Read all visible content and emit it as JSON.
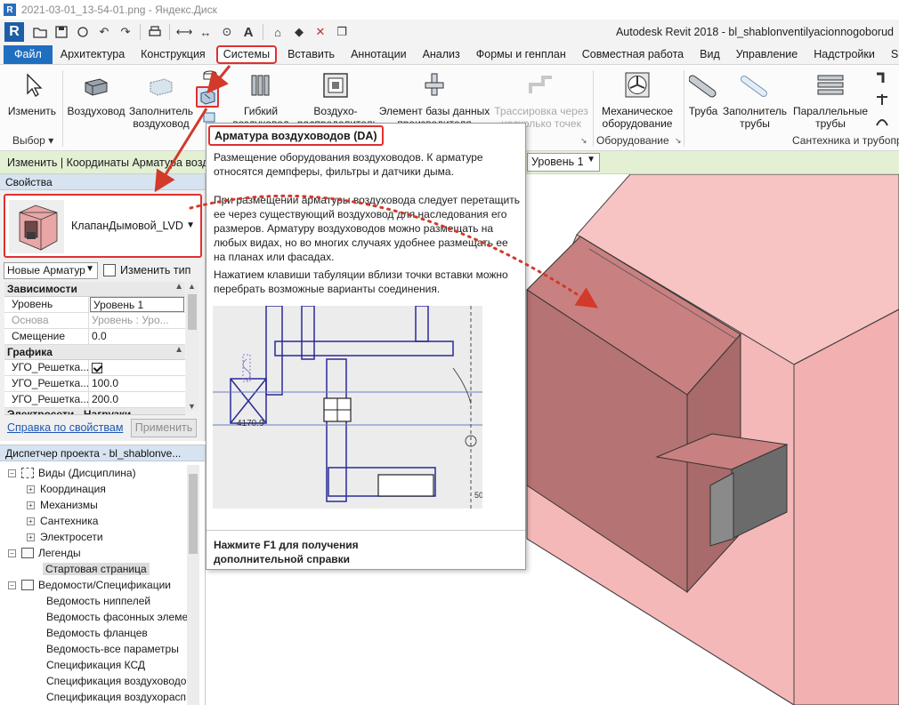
{
  "viewer": {
    "title": "2021-03-01_13-54-01.png - Яндекс.Диск"
  },
  "app": {
    "logo": "R",
    "title": "Autodesk Revit 2018 -    bl_shablonventilyacionnogoborud"
  },
  "qat_icons": [
    "open-icon",
    "save-icon",
    "sync-icon",
    "undo-icon",
    "redo-icon",
    "print-icon",
    "measure-icon",
    "dimension-icon",
    "tag-icon",
    "text-icon",
    "3d-view-icon",
    "section-icon",
    "close-views-icon",
    "switch-windows-icon"
  ],
  "tabs": [
    {
      "label": "Файл",
      "kind": "file"
    },
    {
      "label": "Архитектура"
    },
    {
      "label": "Конструкция"
    },
    {
      "label": "Системы",
      "kind": "active"
    },
    {
      "label": "Вставить"
    },
    {
      "label": "Аннотации"
    },
    {
      "label": "Анализ"
    },
    {
      "label": "Формы и генплан"
    },
    {
      "label": "Совместная работа"
    },
    {
      "label": "Вид"
    },
    {
      "label": "Управление"
    },
    {
      "label": "Надстройки"
    },
    {
      "label": "Site D"
    }
  ],
  "ribbon": {
    "modify": "Изменить",
    "duct": "Воздуховод",
    "duct_placeholder_1": "Заполнитель",
    "duct_placeholder_2": "воздуховод",
    "flex_1": "Гибкий",
    "flex_2": "воздуховод",
    "terminal_1": "Воздухо-",
    "terminal_2": "распределитель",
    "db_1": "Элемент базы данных",
    "db_2": "производителя",
    "route_1": "Трассировка через",
    "route_2": "несколько точек",
    "mech_1": "Механическое",
    "mech_2": "оборудование",
    "pipe": "Труба",
    "pipe_placeholder_1": "Заполнитель",
    "pipe_placeholder_2": "трубы",
    "parallel_1": "Параллельные",
    "parallel_2": "трубы",
    "panel_select": "Выбор",
    "panel_equipment": "Оборудование",
    "panel_plumbing": "Сантехника и трубопр"
  },
  "optbar": {
    "text": "Изменить | Координаты Арматура возду",
    "level": "Уровень 1"
  },
  "properties": {
    "title": "Свойства",
    "type_name": "КлапанДымовой_LVD",
    "instance_filter": "Новые Арматур",
    "edit_type": "Изменить тип",
    "groups": {
      "constraints": "Зависимости",
      "graphics": "Графика",
      "electrical": "Электросети - Нагрузки"
    },
    "rows": {
      "level_k": "Уровень",
      "level_v": "Уровень 1",
      "host_k": "Основа",
      "host_v": "Уровень : Уро...",
      "offset_k": "Смещение",
      "offset_v": "0.0",
      "ugo1_k": "УГО_Решетка...",
      "ugo2_k": "УГО_Решетка...",
      "ugo2_v": "100.0",
      "ugo3_k": "УГО_Решетка...",
      "ugo3_v": "200.0"
    },
    "help_link": "Справка по свойствам",
    "apply": "Применить"
  },
  "browser": {
    "title": "Диспетчер проекта - bl_shablonve...",
    "nodes": {
      "views": "Виды (Дисциплина)",
      "coord": "Координация",
      "mech": "Механизмы",
      "plumb": "Сантехника",
      "elec": "Электросети",
      "legends": "Легенды",
      "start": "Стартовая страница",
      "schedules": "Ведомости/Спецификации",
      "s1": "Ведомость ниппелей",
      "s2": "Ведомость фасонных элеме",
      "s3": "Ведомость фланцев",
      "s4": "Ведомость-все параметры",
      "s5": "Спецификация КСД",
      "s6": "Спецификация воздуховодо",
      "s7": "Спецификация воздухорасп"
    }
  },
  "tooltip": {
    "title": "Арматура воздуховодов (DA)",
    "p1": "Размещение оборудования воздуховодов. К арматуре относятся демпферы, фильтры и датчики дыма.",
    "p2": "При размещении арматуры воздуховода следует перетащить ее через существующий воздуховод для наследования его размеров. Арматуру воздуховодов можно размещать на любых видах, но во многих случаях удобнее размещать ее на планах или фасадах.",
    "p3": "Нажатием клавиши табуляции вблизи точки вставки можно перебрать возможные варианты соединения.",
    "img_dim": "4170.9",
    "img_dim2": "50",
    "footer": "Нажмите F1 для получения дополнительной справки"
  },
  "colors": {
    "accent_tab": "#1f6fc0",
    "highlight": "#e03030",
    "optbar": "#e4f0d4",
    "model_fill": "#f5b8b8",
    "model_dark": "#b57373"
  }
}
